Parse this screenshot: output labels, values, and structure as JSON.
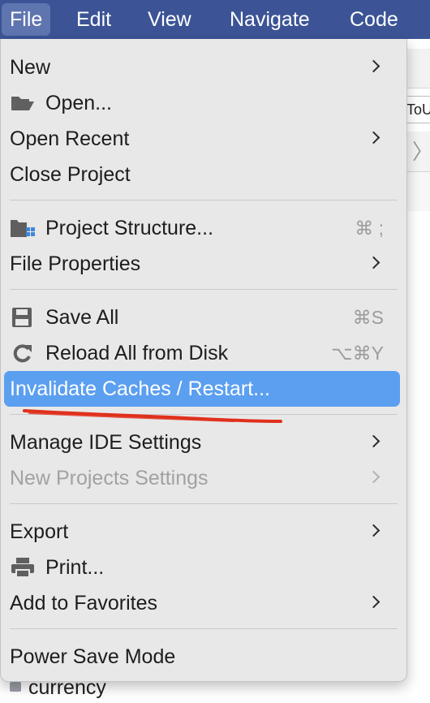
{
  "menubar": {
    "items": [
      "File",
      "Edit",
      "View",
      "Navigate",
      "Code"
    ]
  },
  "background": {
    "tab_text": "ToU",
    "chevron": "〉",
    "bottom_item": "currency"
  },
  "menu": {
    "new": "New",
    "open": "Open...",
    "open_recent": "Open Recent",
    "close_project": "Close Project",
    "project_structure": "Project Structure...",
    "project_structure_shortcut": "⌘ ;",
    "file_properties": "File Properties",
    "save_all": "Save All",
    "save_all_shortcut": "⌘S",
    "reload_all": "Reload All from Disk",
    "reload_all_shortcut": "⌥⌘Y",
    "invalidate_caches": "Invalidate Caches / Restart...",
    "manage_ide_settings": "Manage IDE Settings",
    "new_projects_settings": "New Projects Settings",
    "export": "Export",
    "print": "Print...",
    "add_to_favorites": "Add to Favorites",
    "power_save_mode": "Power Save Mode"
  },
  "colors": {
    "menubar_bg": "#3c5496",
    "highlight": "#5b9ff0",
    "annotation_red": "#e0301c"
  }
}
